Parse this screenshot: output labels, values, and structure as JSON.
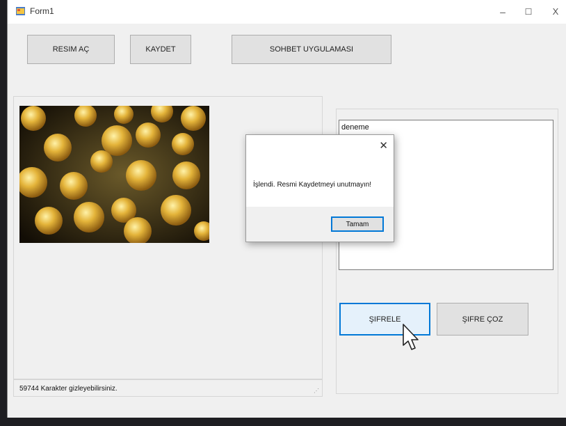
{
  "window": {
    "title": "Form1",
    "minimize_glyph": "–",
    "maximize_glyph": "☐",
    "close_glyph": "X"
  },
  "toolbar": {
    "open_image": "RESIM AÇ",
    "save": "KAYDET",
    "chat_app": "SOHBET UYGULAMASI"
  },
  "image": {
    "description_icon": "gold-coins-image"
  },
  "status": {
    "text": "59744  Karakter gizleyebilirsiniz."
  },
  "textbox": {
    "value": "deneme"
  },
  "actions": {
    "encrypt": "ŞIFRELE",
    "decrypt": "ŞIFRE ÇOZ"
  },
  "dialog": {
    "message": "İşlendi. Resmi Kaydetmeyi unutmayın!",
    "ok_label": "Tamam",
    "close_glyph": "✕"
  },
  "colors": {
    "accent": "#0078d7",
    "window_bg": "#f0f0f0"
  }
}
